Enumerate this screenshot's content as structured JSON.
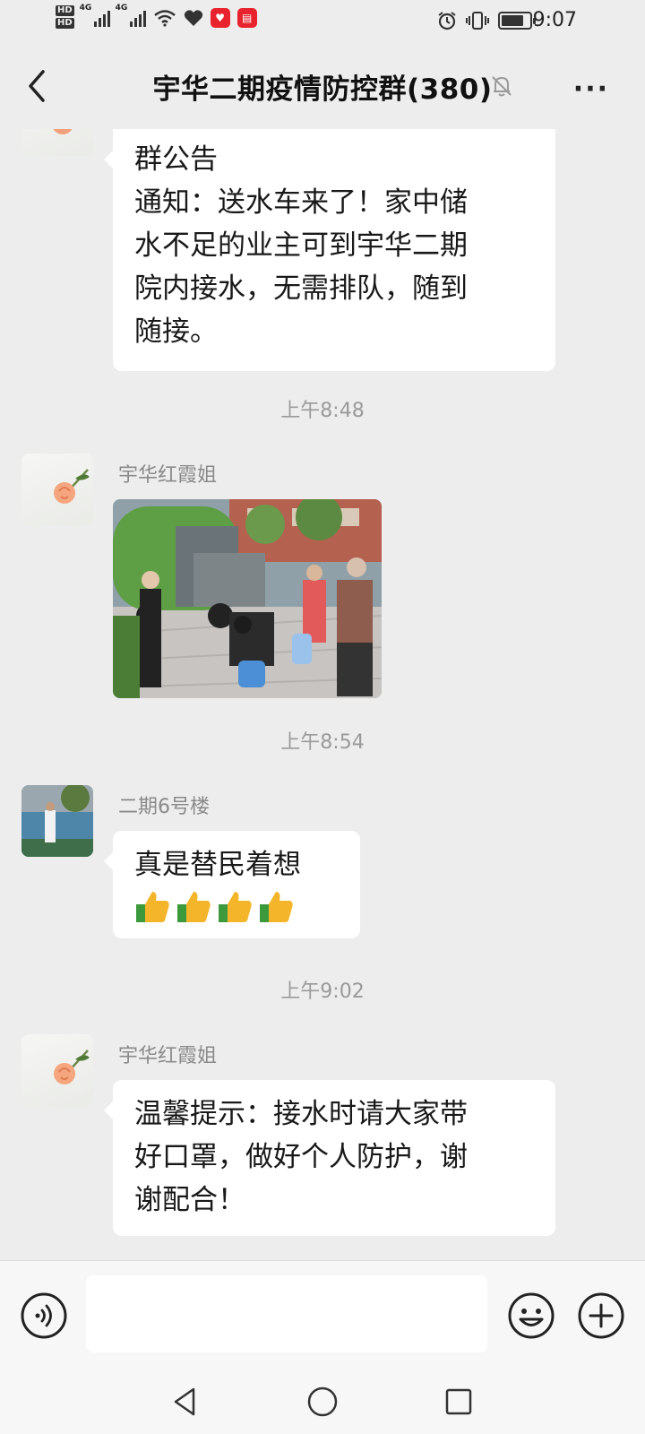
{
  "status_bar": {
    "hd1": "HD",
    "hd2": "HD",
    "net1": "4G",
    "net2": "4G",
    "time": "9:07"
  },
  "header": {
    "title": "宇华二期疫情防控群(380)",
    "more": "···"
  },
  "messages": [
    {
      "type": "text",
      "lines": [
        "群公告",
        "通知：送水车来了！家中储",
        "水不足的业主可到宇华二期",
        "院内接水，无需排队，随到",
        "随接。"
      ]
    },
    {
      "type": "time",
      "text": "上午8:48"
    },
    {
      "type": "image",
      "sender": "宇华红霞姐"
    },
    {
      "type": "time",
      "text": "上午8:54"
    },
    {
      "type": "text",
      "sender": "二期6号楼",
      "lines": [
        "真是替民着想"
      ],
      "thumbs_up": 4
    },
    {
      "type": "time",
      "text": "上午9:02"
    },
    {
      "type": "text",
      "sender": "宇华红霞姐",
      "lines": [
        "温馨提示：接水时请大家带",
        "好口罩，做好个人防护，谢",
        "谢配合！"
      ]
    }
  ],
  "icons": {
    "back": "chevron-left-icon",
    "mute": "bell-off-icon",
    "more": "more-dots-icon",
    "voice": "voice-icon",
    "emoji": "emoji-icon",
    "plus": "plus-icon"
  },
  "colors": {
    "background": "#ededed",
    "bubble": "#ffffff",
    "timestamp": "#9a9a9a",
    "sender": "#8a8a8a"
  }
}
